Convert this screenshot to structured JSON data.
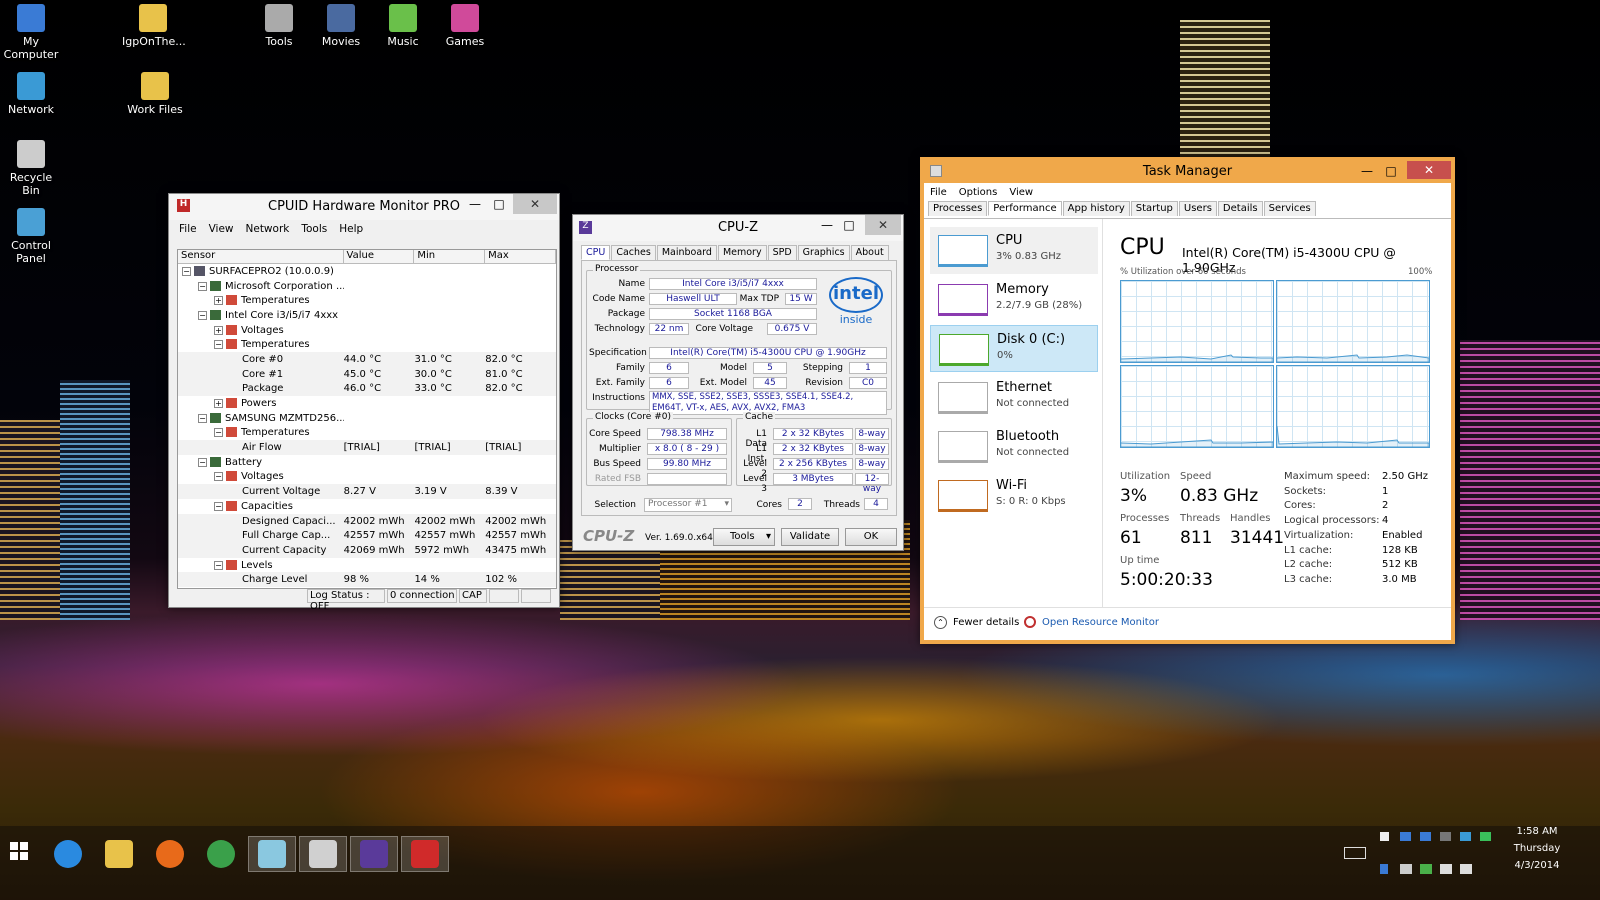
{
  "desktop": {
    "icons": [
      {
        "label": "My\nComputer",
        "icon": "computer-icon",
        "color": "#3a7bd5"
      },
      {
        "label": "IgpOnThe...",
        "icon": "folder-icon",
        "color": "#e8c24a"
      },
      {
        "label": "Tools",
        "icon": "tools-icon",
        "color": "#aaa"
      },
      {
        "label": "Movies",
        "icon": "film-icon",
        "color": "#4a6aa0"
      },
      {
        "label": "Music",
        "icon": "disc-icon",
        "color": "#6ac04a"
      },
      {
        "label": "Games",
        "icon": "games-icon",
        "color": "#d04a9a"
      },
      {
        "label": "Network",
        "icon": "network-icon",
        "color": "#3a9ad5"
      },
      {
        "label": "Work Files",
        "icon": "folder-icon",
        "color": "#e8c24a"
      },
      {
        "label": "Recycle Bin",
        "icon": "recycle-bin-icon",
        "color": "#cccccc"
      },
      {
        "label": "Control Panel",
        "icon": "control-panel-icon",
        "color": "#4aa0d5"
      }
    ]
  },
  "hwmon": {
    "title": "CPUID Hardware Monitor PRO",
    "menu": [
      "File",
      "View",
      "Network",
      "Tools",
      "Help"
    ],
    "columns": [
      "Sensor",
      "Value",
      "Min",
      "Max"
    ],
    "rows": [
      {
        "indent": 0,
        "exp": "-",
        "name": "SURFACEPRO2 (10.0.0.9)",
        "v": "",
        "mn": "",
        "mx": ""
      },
      {
        "indent": 1,
        "exp": "-",
        "name": "Microsoft Corporation ...",
        "v": "",
        "mn": "",
        "mx": ""
      },
      {
        "indent": 2,
        "exp": "+",
        "name": "Temperatures",
        "v": "",
        "mn": "",
        "mx": ""
      },
      {
        "indent": 1,
        "exp": "-",
        "name": "Intel Core i3/i5/i7 4xxx",
        "v": "",
        "mn": "",
        "mx": ""
      },
      {
        "indent": 2,
        "exp": "+",
        "name": "Voltages",
        "v": "",
        "mn": "",
        "mx": ""
      },
      {
        "indent": 2,
        "exp": "-",
        "name": "Temperatures",
        "v": "",
        "mn": "",
        "mx": ""
      },
      {
        "indent": 3,
        "exp": "",
        "name": "Core #0",
        "v": "44.0 °C",
        "mn": "31.0 °C",
        "mx": "82.0 °C"
      },
      {
        "indent": 3,
        "exp": "",
        "name": "Core #1",
        "v": "45.0 °C",
        "mn": "30.0 °C",
        "mx": "81.0 °C"
      },
      {
        "indent": 3,
        "exp": "",
        "name": "Package",
        "v": "46.0 °C",
        "mn": "33.0 °C",
        "mx": "82.0 °C"
      },
      {
        "indent": 2,
        "exp": "+",
        "name": "Powers",
        "v": "",
        "mn": "",
        "mx": ""
      },
      {
        "indent": 1,
        "exp": "-",
        "name": "SAMSUNG MZMTD256...",
        "v": "",
        "mn": "",
        "mx": ""
      },
      {
        "indent": 2,
        "exp": "-",
        "name": "Temperatures",
        "v": "",
        "mn": "",
        "mx": ""
      },
      {
        "indent": 3,
        "exp": "",
        "name": "Air Flow",
        "v": "[TRIAL]",
        "mn": "[TRIAL]",
        "mx": "[TRIAL]"
      },
      {
        "indent": 1,
        "exp": "-",
        "name": "Battery",
        "v": "",
        "mn": "",
        "mx": ""
      },
      {
        "indent": 2,
        "exp": "-",
        "name": "Voltages",
        "v": "",
        "mn": "",
        "mx": ""
      },
      {
        "indent": 3,
        "exp": "",
        "name": "Current Voltage",
        "v": "8.27 V",
        "mn": "3.19 V",
        "mx": "8.39 V"
      },
      {
        "indent": 2,
        "exp": "-",
        "name": "Capacities",
        "v": "",
        "mn": "",
        "mx": ""
      },
      {
        "indent": 3,
        "exp": "",
        "name": "Designed Capaci...",
        "v": "42002 mWh",
        "mn": "42002 mWh",
        "mx": "42002 mWh"
      },
      {
        "indent": 3,
        "exp": "",
        "name": "Full Charge Cap...",
        "v": "42557 mWh",
        "mn": "42557 mWh",
        "mx": "42557 mWh"
      },
      {
        "indent": 3,
        "exp": "",
        "name": "Current Capacity",
        "v": "42069 mWh",
        "mn": "5972 mWh",
        "mx": "43475 mWh"
      },
      {
        "indent": 2,
        "exp": "-",
        "name": "Levels",
        "v": "",
        "mn": "",
        "mx": ""
      },
      {
        "indent": 3,
        "exp": "",
        "name": "Charge Level",
        "v": "98 %",
        "mn": "14 %",
        "mx": "102 %"
      }
    ],
    "status": [
      "Log Status : OFF",
      "0 connection",
      "CAP"
    ]
  },
  "cpuz": {
    "title": "CPU-Z",
    "tabs": [
      "CPU",
      "Caches",
      "Mainboard",
      "Memory",
      "SPD",
      "Graphics",
      "About"
    ],
    "processor_title": "Processor",
    "name_label": "Name",
    "name": "Intel Core i3/i5/i7 4xxx",
    "codename_label": "Code Name",
    "codename": "Haswell ULT",
    "maxtdp_label": "Max TDP",
    "maxtdp": "15 W",
    "package_label": "Package",
    "package": "Socket 1168 BGA",
    "tech_label": "Technology",
    "tech": "22 nm",
    "vcore_label": "Core Voltage",
    "vcore": "0.675 V",
    "spec_label": "Specification",
    "spec": "Intel(R) Core(TM) i5-4300U CPU @ 1.90GHz",
    "family_label": "Family",
    "family": "6",
    "model_label": "Model",
    "model": "5",
    "stepping_label": "Stepping",
    "stepping": "1",
    "extfam_label": "Ext. Family",
    "extfam": "6",
    "extmodel_label": "Ext. Model",
    "extmodel": "45",
    "revision_label": "Revision",
    "revision": "C0",
    "instr_label": "Instructions",
    "instr": "MMX, SSE, SSE2, SSE3, SSSE3, SSE4.1, SSE4.2, EM64T, VT-x, AES, AVX, AVX2, FMA3",
    "clocks_title": "Clocks (Core #0)",
    "corespeed_label": "Core Speed",
    "corespeed": "798.38 MHz",
    "mult_label": "Multiplier",
    "mult": "x 8.0 ( 8 - 29 )",
    "bus_label": "Bus Speed",
    "bus": "99.80 MHz",
    "fsb_label": "Rated FSB",
    "cache_title": "Cache",
    "l1d_label": "L1 Data",
    "l1d": "2 x 32 KBytes",
    "l1d_w": "8-way",
    "l1i_label": "L1 Inst.",
    "l1i": "2 x 32 KBytes",
    "l1i_w": "8-way",
    "l2_label": "Level 2",
    "l2": "2 x 256 KBytes",
    "l2_w": "8-way",
    "l3_label": "Level 3",
    "l3": "3 MBytes",
    "l3_w": "12-way",
    "selection_label": "Selection",
    "selection": "Processor #1",
    "cores_label": "Cores",
    "cores": "2",
    "threads_label": "Threads",
    "threads": "4",
    "logo": "CPU-Z",
    "version": "Ver. 1.69.0.x64",
    "tools": "Tools",
    "validate": "Validate",
    "ok": "OK",
    "intel_logo": "intel",
    "intel_inside": "inside"
  },
  "taskmgr": {
    "title": "Task Manager",
    "menu": [
      "File",
      "Options",
      "View"
    ],
    "tabs": [
      "Processes",
      "Performance",
      "App history",
      "Startup",
      "Users",
      "Details",
      "Services"
    ],
    "side": [
      {
        "t1": "CPU",
        "t2": "3% 0.83 GHz",
        "color": "#4b9bd1"
      },
      {
        "t1": "Memory",
        "t2": "2.2/7.9 GB (28%)",
        "color": "#8b3bb0"
      },
      {
        "t1": "Disk 0 (C:)",
        "t2": "0%",
        "color": "#4da82c"
      },
      {
        "t1": "Ethernet",
        "t2": "Not connected",
        "color": "#aaaaaa"
      },
      {
        "t1": "Bluetooth",
        "t2": "Not connected",
        "color": "#aaaaaa"
      },
      {
        "t1": "Wi-Fi",
        "t2": "S: 0 R: 0 Kbps",
        "color": "#c06a20"
      }
    ],
    "cpu_title": "CPU",
    "cpu_model": "Intel(R) Core(TM) i5-4300U CPU @ 1.90GHz",
    "graph_label": "% Utilization over 60 seconds",
    "graph_max": "100%",
    "util_label": "Utilization",
    "util": "3%",
    "speed_label": "Speed",
    "speed": "0.83 GHz",
    "proc_label": "Processes",
    "proc": "61",
    "threads_label": "Threads",
    "threads": "811",
    "handles_label": "Handles",
    "handles": "31441",
    "uptime_label": "Up time",
    "uptime": "5:00:20:33",
    "specs": [
      {
        "k": "Maximum speed:",
        "v": "2.50 GHz"
      },
      {
        "k": "Sockets:",
        "v": "1"
      },
      {
        "k": "Cores:",
        "v": "2"
      },
      {
        "k": "Logical processors:",
        "v": "4"
      },
      {
        "k": "Virtualization:",
        "v": "Enabled"
      },
      {
        "k": "L1 cache:",
        "v": "128 KB"
      },
      {
        "k": "L2 cache:",
        "v": "512 KB"
      },
      {
        "k": "L3 cache:",
        "v": "3.0 MB"
      }
    ],
    "fewer": "Fewer details",
    "resmon": "Open Resource Monitor"
  },
  "taskbar": {
    "apps": [
      {
        "icon": "internet-explorer-icon",
        "color": "#2a8ae0"
      },
      {
        "icon": "file-explorer-icon",
        "color": "#e8c24a"
      },
      {
        "icon": "firefox-icon",
        "color": "#e86a1a"
      },
      {
        "icon": "chrome-icon",
        "color": "#3aa04a"
      },
      {
        "icon": "app-icon",
        "color": "#8ac8e0"
      },
      {
        "icon": "image-viewer-icon",
        "color": "#d0d0d0"
      },
      {
        "icon": "cpuz-icon",
        "color": "#5a3a9a"
      },
      {
        "icon": "hwmonitor-icon",
        "color": "#d02a2a"
      }
    ],
    "time": "1:58 AM",
    "day": "Thursday",
    "date": "4/3/2014"
  }
}
